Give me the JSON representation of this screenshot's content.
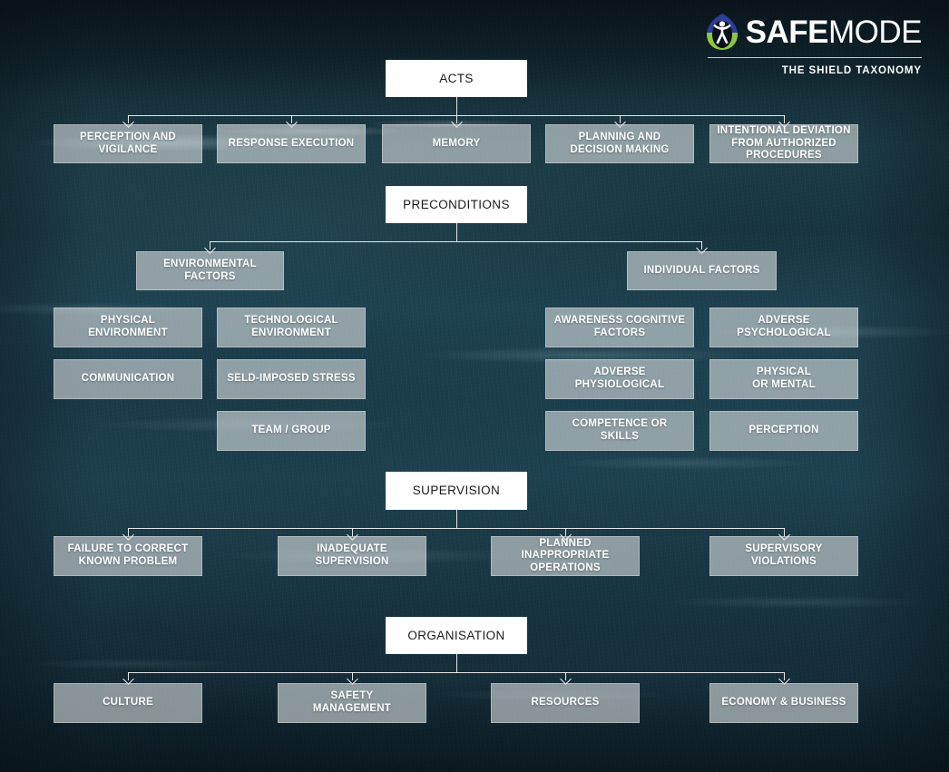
{
  "brand": {
    "logo_icon": "safemode-leaf-figure-icon",
    "word_part1": "SAFE",
    "word_part2": "MODE",
    "tagline": "THE SHIELD TAXONOMY",
    "accent_blue": "#2b3f96",
    "accent_green": "#8cc63f",
    "box_white": "#ffffff",
    "box_grey": "rgba(225,230,230,0.58)",
    "line_color": "#ffffff"
  },
  "diagram": {
    "title": "THE SHIELD TAXONOMY",
    "levels": [
      {
        "id": "acts",
        "category": "ACTS",
        "children": [
          "PERCEPTION AND VIGILANCE",
          "RESPONSE EXECUTION",
          "MEMORY",
          "PLANNING AND DECISION MAKING",
          "INTENTIONAL DEVIATION FROM AUTHORIZED PROCEDURES"
        ]
      },
      {
        "id": "preconditions",
        "category": "PRECONDITIONS",
        "groups": [
          {
            "name": "ENVIRONMENTAL FACTORS",
            "children": [
              "PHYSICAL ENVIRONMENT",
              "TECHNOLOGICAL ENVIRONMENT",
              "COMMUNICATION",
              "SELD-IMPOSED STRESS",
              "TEAM / GROUP"
            ]
          },
          {
            "name": "INDIVIDUAL FACTORS",
            "children": [
              "AWARENESS COGNITIVE FACTORS",
              "ADVERSE PSYCHOLOGICAL",
              "ADVERSE PHYSIOLOGICAL",
              "PHYSICAL OR MENTAL",
              "COMPETENCE OR SKILLS",
              "PERCEPTION"
            ]
          }
        ]
      },
      {
        "id": "supervision",
        "category": "SUPERVISION",
        "children": [
          "FAILURE TO CORRECT KNOWN PROBLEM",
          "INADEQUATE SUPERVISION",
          "PLANNED INAPPROPRIATE OPERATIONS",
          "SUPERVISORY VIOLATIONS"
        ]
      },
      {
        "id": "organisation",
        "category": "ORGANISATION",
        "children": [
          "CULTURE",
          "SAFETY MANAGEMENT",
          "RESOURCES",
          "ECONOMY & BUSINESS"
        ]
      }
    ],
    "nodes": {
      "acts": "ACTS",
      "acts_1": "PERCEPTION AND\nVIGILANCE",
      "acts_2": "RESPONSE EXECUTION",
      "acts_3": "MEMORY",
      "acts_4": "PLANNING AND\nDECISION MAKING",
      "acts_5": "INTENTIONAL DEVIATION\nFROM AUTHORIZED\nPROCEDURES",
      "preconditions": "PRECONDITIONS",
      "env_factors": "ENVIRONMENTAL\nFACTORS",
      "ind_factors": "INDIVIDUAL FACTORS",
      "env_1": "PHYSICAL\nENVIRONMENT",
      "env_2": "TECHNOLOGICAL\nENVIRONMENT",
      "env_3": "COMMUNICATION",
      "env_4": "SELD-IMPOSED STRESS",
      "env_5": "TEAM / GROUP",
      "ind_1": "AWARENESS COGNITIVE\nFACTORS",
      "ind_2": "ADVERSE\nPSYCHOLOGICAL",
      "ind_3": "ADVERSE\nPHYSIOLOGICAL",
      "ind_4": "PHYSICAL\nOR MENTAL",
      "ind_5": "COMPETENCE OR SKILLS",
      "ind_6": "PERCEPTION",
      "supervision": "SUPERVISION",
      "sup_1": "FAILURE TO CORRECT\nKNOWN PROBLEM",
      "sup_2": "INADEQUATE\nSUPERVISION",
      "sup_3": "PLANNED\nINAPPROPRIATE\nOPERATIONS",
      "sup_4": "SUPERVISORY\nVIOLATIONS",
      "organisation": "ORGANISATION",
      "org_1": "CULTURE",
      "org_2": "SAFETY\nMANAGEMENT",
      "org_3": "RESOURCES",
      "org_4": "ECONOMY & BUSINESS"
    }
  }
}
